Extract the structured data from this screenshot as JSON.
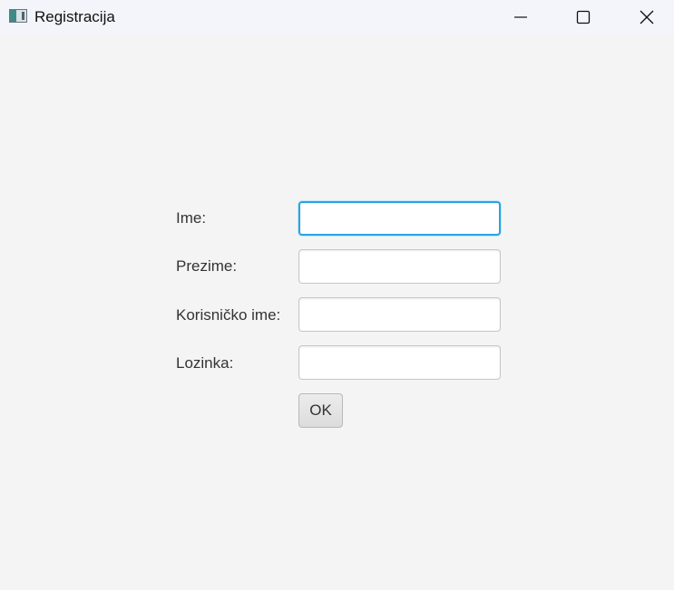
{
  "window": {
    "title": "Registracija"
  },
  "form": {
    "fields": [
      {
        "label": "Ime:",
        "value": "",
        "placeholder": ""
      },
      {
        "label": "Prezime:",
        "value": "",
        "placeholder": ""
      },
      {
        "label": "Korisničko ime:",
        "value": "",
        "placeholder": ""
      },
      {
        "label": "Lozinka:",
        "value": "",
        "placeholder": ""
      }
    ],
    "submit_label": "OK"
  },
  "colors": {
    "background": "#f4f4f4",
    "titlebar": "#f3f5fb",
    "focus_accent": "#2aa3e0"
  }
}
